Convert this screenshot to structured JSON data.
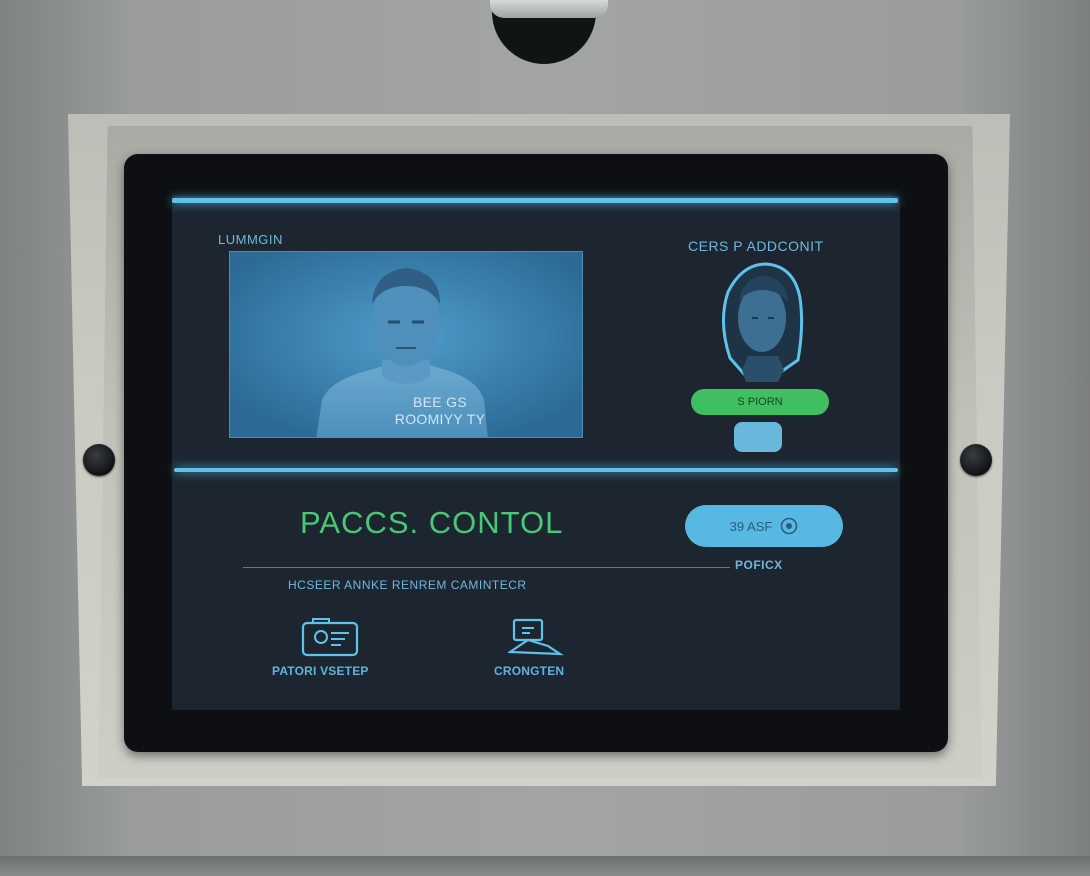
{
  "panel": {
    "feed_label": "LUMMGIN",
    "profile_label": "CERS P ADDCONIT",
    "feed_overlay_line1": "BEE GS",
    "feed_overlay_line2": "ROOMIYY TY",
    "status_pill": "S PIORN",
    "title": "PACCS. CONTOL",
    "action_button": "39 ASF",
    "action_caption": "POFICX",
    "subtitle": "HCSEER ANNKE RENREM CAMINTECR",
    "icons": [
      {
        "name": "id-card-icon",
        "label": "PATORI VSETEP"
      },
      {
        "name": "connection-icon",
        "label": "CRONGTEN"
      }
    ]
  },
  "colors": {
    "accent_blue": "#5fc2ea",
    "accent_green": "#48c774",
    "screen_bg": "#1d2630"
  }
}
